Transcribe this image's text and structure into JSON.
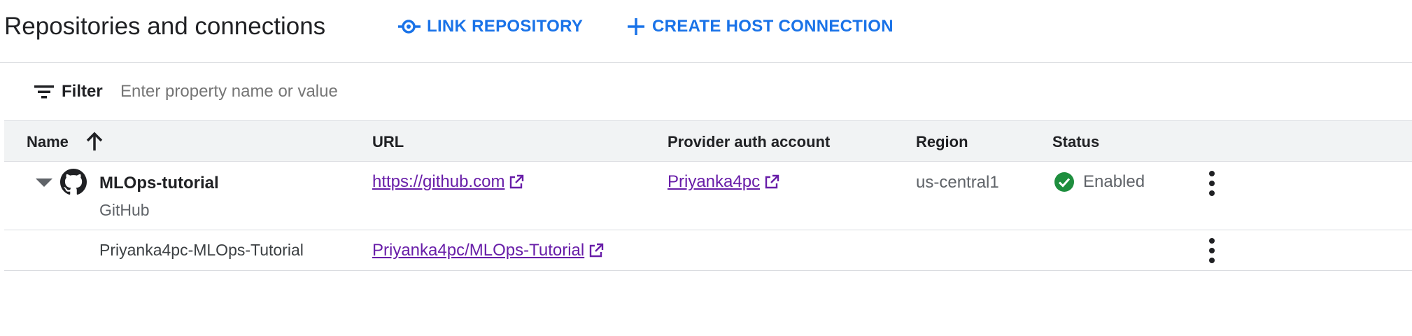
{
  "header": {
    "title": "Repositories and connections",
    "link_repository_label": "LINK REPOSITORY",
    "create_connection_label": "CREATE HOST CONNECTION"
  },
  "filter": {
    "label": "Filter",
    "placeholder": "Enter property name or value",
    "value": ""
  },
  "table": {
    "columns": {
      "name": "Name",
      "url": "URL",
      "provider_auth_account": "Provider auth account",
      "region": "Region",
      "status": "Status"
    },
    "sort": {
      "column": "Name",
      "direction": "ascending"
    },
    "connection": {
      "name": "MLOps-tutorial",
      "provider": "GitHub",
      "url": "https://github.com",
      "auth_account": "Priyanka4pc",
      "region": "us-central1",
      "status": "Enabled",
      "expanded": true
    },
    "repositories": [
      {
        "name": "Priyanka4pc-MLOps-Tutorial",
        "url": "Priyanka4pc/MLOps-Tutorial"
      }
    ]
  },
  "colors": {
    "accent": "#1a73e8",
    "visited_link": "#681da8",
    "status_ok": "#1e8e3e",
    "header_bg": "#f1f3f4",
    "divider": "#dadce0"
  },
  "icons": {
    "link_repository": "link-repo-icon",
    "create_connection": "plus-icon",
    "filter": "filter-list-icon",
    "sort": "arrow-up-icon",
    "expand": "triangle-down-icon",
    "provider": "github-icon",
    "external": "open-in-new-icon",
    "status": "check-circle-icon",
    "row_menu": "more-vert-icon"
  }
}
